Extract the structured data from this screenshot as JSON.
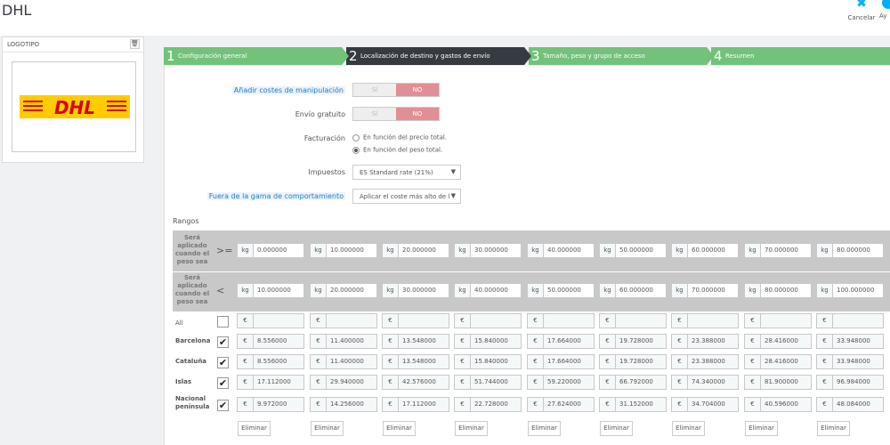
{
  "header": {
    "title": "DHL",
    "cancel_label": "Cancelar",
    "help_label": "Ay"
  },
  "logo_panel": {
    "title": "LOGOTIPO",
    "logo_text": "DHL"
  },
  "steps": [
    {
      "num": "1",
      "label": "Configuración general"
    },
    {
      "num": "2",
      "label": "Localización de destino y gastos de envío"
    },
    {
      "num": "3",
      "label": "Tamaño, peso y grupo de acceso"
    },
    {
      "num": "4",
      "label": "Resumen"
    }
  ],
  "form": {
    "handling": {
      "label": "Añadir costes de manipulación",
      "yes": "SÍ",
      "no": "NO"
    },
    "free": {
      "label": "Envío gratuito",
      "yes": "SÍ",
      "no": "NO"
    },
    "billing": {
      "label": "Facturación",
      "opt1": "En función del precio total.",
      "opt2": "En función del peso total."
    },
    "tax": {
      "label": "Impuestos",
      "value": "ES Standard rate (21%)"
    },
    "out_of_range": {
      "label": "Fuera de la gama de comportamiento",
      "value": "Aplicar el coste más alto de l"
    }
  },
  "ranges": {
    "title": "Rangos",
    "row_from_label": "Será aplicado cuando el peso sea",
    "row_from_op": ">=",
    "row_to_label": "Será aplicado cuando el peso sea",
    "row_to_op": "<",
    "unit_weight": "kg",
    "unit_price": "€",
    "from": [
      "0.000000",
      "10.000000",
      "20.000000",
      "30.000000",
      "40.000000",
      "50.000000",
      "60.000000",
      "70.000000",
      "80.000000"
    ],
    "to": [
      "10.000000",
      "20.000000",
      "30.000000",
      "40.000000",
      "50.000000",
      "60.000000",
      "70.000000",
      "80.000000",
      "100.000000"
    ],
    "all_label": "All",
    "zones": [
      {
        "name": "Barcelona",
        "prices": [
          "8.556000",
          "11.400000",
          "13.548000",
          "15.840000",
          "17.664000",
          "19.728000",
          "23.388000",
          "28.416000",
          "33.948000"
        ]
      },
      {
        "name": "Cataluña",
        "prices": [
          "8.556000",
          "11.400000",
          "13.548000",
          "15.840000",
          "17.664000",
          "19.728000",
          "23.388000",
          "28.416000",
          "33.948000"
        ]
      },
      {
        "name": "Islas",
        "prices": [
          "17.112000",
          "29.940000",
          "42.576000",
          "51.744000",
          "59.220000",
          "66.792000",
          "74.340000",
          "81.900000",
          "96.984000"
        ]
      },
      {
        "name": "Nacional península",
        "prices": [
          "9.972000",
          "14.256000",
          "17.112000",
          "22.728000",
          "27.624000",
          "31.152000",
          "34.704000",
          "40.596000",
          "48.084000"
        ]
      }
    ],
    "delete_label": "Eliminar"
  }
}
